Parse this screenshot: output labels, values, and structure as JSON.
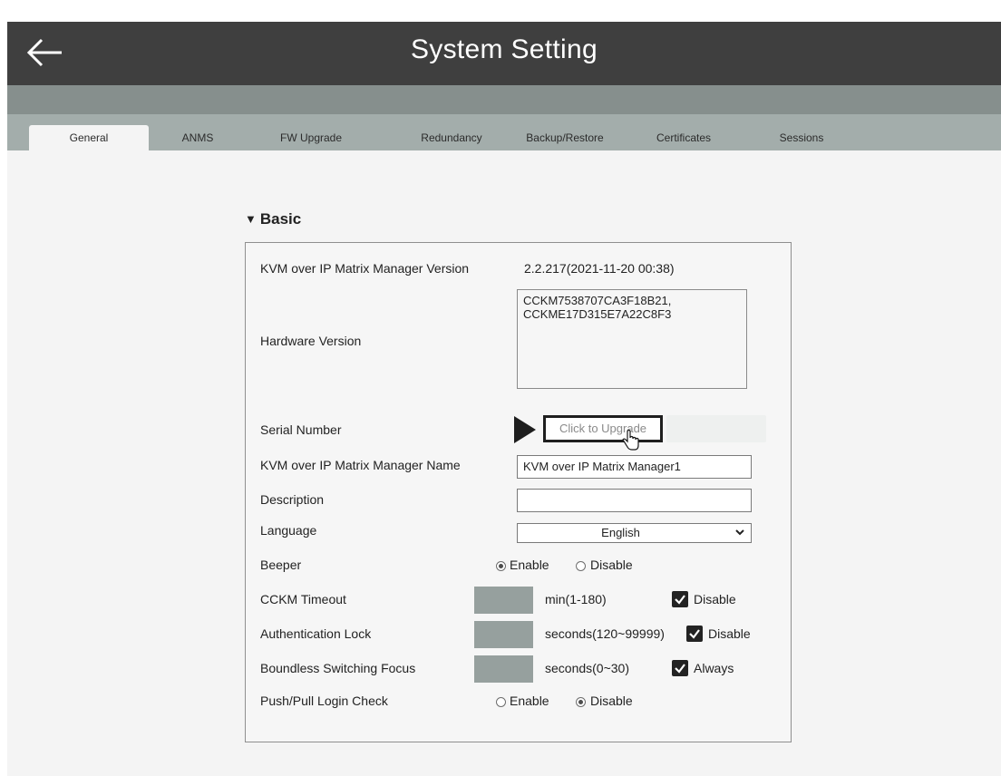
{
  "header": {
    "title": "System Setting",
    "back_icon": "arrow-left-icon"
  },
  "tabs": [
    {
      "label": "General",
      "active": true
    },
    {
      "label": "ANMS"
    },
    {
      "label": "FW Upgrade"
    },
    {
      "label": "Redundancy"
    },
    {
      "label": "Backup/Restore"
    },
    {
      "label": "Certificates"
    },
    {
      "label": "Sessions"
    }
  ],
  "section": {
    "title": "Basic"
  },
  "fields": {
    "version": {
      "label": "KVM over IP Matrix Manager Version",
      "value": "2.2.217(2021-11-20 00:38)"
    },
    "hardware": {
      "label": "Hardware Version",
      "lines": [
        "CCKM7538707CA3F18B21,",
        "CCKME17D315E7A22C8F3"
      ]
    },
    "serial": {
      "label": "Serial Number",
      "button": "Click to Upgrade"
    },
    "name": {
      "label": "KVM over IP Matrix Manager Name",
      "value": "KVM over IP Matrix Manager1"
    },
    "description": {
      "label": "Description",
      "value": ""
    },
    "language": {
      "label": "Language",
      "value": "English"
    },
    "beeper": {
      "label": "Beeper",
      "enable": "Enable",
      "disable": "Disable",
      "selected": "Enable"
    },
    "cckm_timeout": {
      "label": "CCKM Timeout",
      "unit": "min(1-180)",
      "checkbox": "Disable",
      "checked": true
    },
    "auth_lock": {
      "label": "Authentication Lock",
      "unit": "seconds(120~99999)",
      "checkbox": "Disable",
      "checked": true
    },
    "boundless": {
      "label": "Boundless Switching Focus",
      "unit": "seconds(0~30)",
      "checkbox": "Always",
      "checked": true
    },
    "pushpull": {
      "label": "Push/Pull Login Check",
      "enable": "Enable",
      "disable": "Disable",
      "selected": "Disable"
    }
  },
  "colors": {
    "titlebar": "#3f3f3f",
    "subbar": "#868f8d",
    "tabbar": "#a3adab",
    "input_gray": "#96a09e"
  }
}
